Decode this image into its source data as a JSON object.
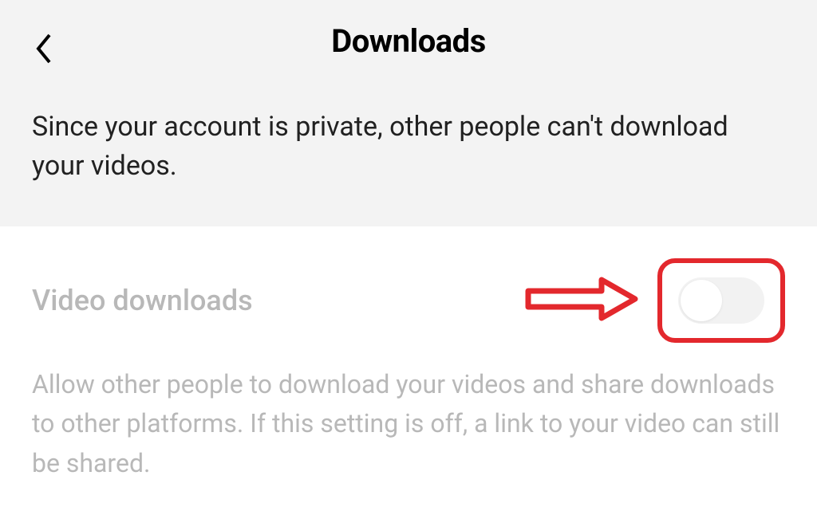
{
  "header": {
    "title": "Downloads"
  },
  "info": {
    "text": "Since your account is private, other people can't download your videos."
  },
  "settings": {
    "video_downloads": {
      "title": "Video downloads",
      "description": "Allow other people to download your videos and share downloads to other platforms. If this setting is off, a link to your video can still be shared.",
      "enabled": false
    }
  },
  "annotation": {
    "arrow_color": "#e3282d",
    "highlight_box_color": "#e3282d"
  }
}
